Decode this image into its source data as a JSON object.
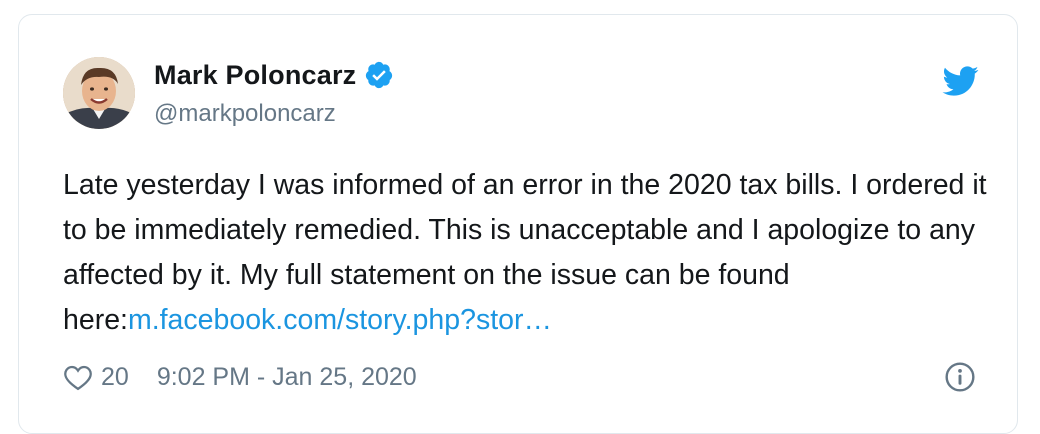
{
  "author": {
    "display_name": "Mark Poloncarz",
    "handle": "@markpoloncarz",
    "verified": true
  },
  "tweet": {
    "text": "Late yesterday I was informed of an error in the 2020 tax bills. I ordered it to be immediately remedied. This is unacceptable and I apologize to any affected by it. My full statement on the issue can be found here:",
    "link_text": "m.facebook.com/story.php?stor…"
  },
  "footer": {
    "like_count": "20",
    "timestamp": "9:02 PM - Jan 25, 2020"
  },
  "icons": {
    "brand": "twitter-bird-icon",
    "verified": "verified-badge-icon",
    "like": "heart-icon",
    "info": "info-icon"
  },
  "colors": {
    "brand_blue": "#1da1f2",
    "link_blue": "#1b95e0",
    "text": "#14171a",
    "muted": "#657786",
    "border": "#e1e8ed"
  }
}
